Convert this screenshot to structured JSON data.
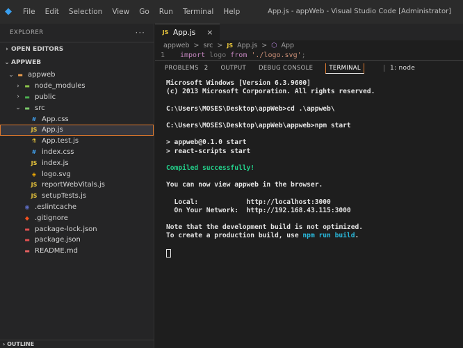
{
  "menu": [
    "File",
    "Edit",
    "Selection",
    "View",
    "Go",
    "Run",
    "Terminal",
    "Help"
  ],
  "window_title": "App.js - appWeb - Visual Studio Code [Administrator]",
  "explorer": {
    "header": "EXPLORER",
    "more": "···",
    "open_editors": "OPEN EDITORS",
    "project": "APPWEB",
    "tree": [
      {
        "label": "appweb",
        "icon": "folder-icon",
        "chevron": "⌄",
        "indent": 1
      },
      {
        "label": "node_modules",
        "icon": "folder-icon",
        "chevron": "›",
        "indent": 2
      },
      {
        "label": "public",
        "icon": "folder-icon",
        "chevron": "›",
        "indent": 2
      },
      {
        "label": "src",
        "icon": "folder-icon",
        "chevron": "⌄",
        "indent": 2
      },
      {
        "label": "App.css",
        "icon": "css-file-icon",
        "indent": 3
      },
      {
        "label": "App.js",
        "icon": "js-file-icon",
        "indent": 3,
        "selected": true
      },
      {
        "label": "App.test.js",
        "icon": "test-file-icon",
        "indent": 3
      },
      {
        "label": "index.css",
        "icon": "css-file-icon",
        "indent": 3
      },
      {
        "label": "index.js",
        "icon": "js-file-icon",
        "indent": 3
      },
      {
        "label": "logo.svg",
        "icon": "svg-file-icon",
        "indent": 3
      },
      {
        "label": "reportWebVitals.js",
        "icon": "js-file-icon",
        "indent": 3
      },
      {
        "label": "setupTests.js",
        "icon": "js-file-icon",
        "indent": 3
      },
      {
        "label": ".eslintcache",
        "icon": "eslint-file-icon",
        "indent": 2
      },
      {
        "label": ".gitignore",
        "icon": "git-file-icon",
        "indent": 2
      },
      {
        "label": "package-lock.json",
        "icon": "json-file-icon",
        "indent": 2
      },
      {
        "label": "package.json",
        "icon": "json-file-icon",
        "indent": 2
      },
      {
        "label": "README.md",
        "icon": "markdown-file-icon",
        "indent": 2
      }
    ],
    "outline": "OUTLINE"
  },
  "editor": {
    "tab": {
      "icon_text": "JS",
      "label": "App.js",
      "close": "×"
    },
    "breadcrumb": [
      "appweb",
      ">",
      "src",
      ">",
      "JS",
      "App.js",
      ">",
      "App"
    ],
    "code_line": {
      "number": "1",
      "keyword": "import",
      "ident": " logo ",
      "from": "from",
      "string": " './logo.svg'",
      "end": ";"
    }
  },
  "panel": {
    "tabs": [
      "PROBLEMS",
      "OUTPUT",
      "DEBUG CONSOLE",
      "TERMINAL"
    ],
    "problems_count": "2",
    "terminal_select": "1: node"
  },
  "terminal": {
    "l1": "Microsoft Windows [Version 6.3.9600]",
    "l2": "(c) 2013 Microsoft Corporation. All rights reserved.",
    "l3": "C:\\Users\\MOSES\\Desktop\\appWeb>cd .\\appweb\\",
    "l4": "C:\\Users\\MOSES\\Desktop\\appWeb\\appweb>npm start",
    "l5": "> appweb@0.1.0 start",
    "l6": "> react-scripts start",
    "l7": "Compiled successfully!",
    "l8": "You can now view appweb in the browser.",
    "l9_label": "  Local:            ",
    "l9_value": "http://localhost:3000",
    "l10_label": "  On Your Network:  ",
    "l10_value": "http://192.168.43.115:3000",
    "l11": "Note that the development build is not optimized.",
    "l12_pre": "To create a production build, use ",
    "l12_cmd": "npm run build",
    "l12_post": "."
  }
}
